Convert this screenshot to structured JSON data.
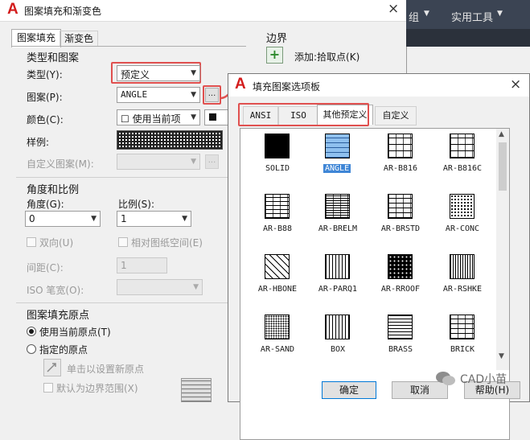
{
  "main_dialog": {
    "title": "图案填充和渐变色",
    "close_glyph": "×",
    "tabs": [
      "图案填充",
      "渐变色"
    ],
    "type_and_pattern": {
      "section": "类型和图案",
      "type_label": "类型(Y):",
      "type_value": "预定义",
      "pattern_label": "图案(P):",
      "pattern_value": "ANGLE",
      "browse_label": "...",
      "color_label": "颜色(C):",
      "color_value": "☐ 使用当前项",
      "swatch_label": "样例:",
      "custom_label": "自定义图案(M):"
    },
    "angle_scale": {
      "section": "角度和比例",
      "angle_label": "角度(G):",
      "angle_value": "0",
      "scale_label": "比例(S):",
      "scale_value": "1",
      "double_label": "双向(U)",
      "relative_label": "相对图纸空间(E)",
      "spacing_label": "间距(C):",
      "spacing_value": "1",
      "iso_label": "ISO 笔宽(O):"
    },
    "origin": {
      "section": "图案填充原点",
      "use_current": "使用当前原点(T)",
      "specified": "指定的原点",
      "click_set": "单击以设置新原点",
      "default_boundary": "默认为边界范围(X)"
    },
    "boundary": {
      "section": "边界",
      "pick_points": "添加:拾取点(K)",
      "pick_icon": "add-pick-point-icon"
    }
  },
  "ribbon": {
    "item1": "组",
    "item2": "实用工具"
  },
  "palette_dialog": {
    "title": "填充图案选项板",
    "close_glyph": "×",
    "tabs": [
      "ANSI",
      "ISO",
      "其他预定义",
      "自定义"
    ],
    "active_tab": "其他预定义",
    "patterns": [
      {
        "name": "SOLID",
        "selected": false
      },
      {
        "name": "ANGLE",
        "selected": true
      },
      {
        "name": "AR-B816",
        "selected": false
      },
      {
        "name": "AR-B816C",
        "selected": false
      },
      {
        "name": "AR-B88",
        "selected": false
      },
      {
        "name": "AR-BRELM",
        "selected": false
      },
      {
        "name": "AR-BRSTD",
        "selected": false
      },
      {
        "name": "AR-CONC",
        "selected": false
      },
      {
        "name": "AR-HBONE",
        "selected": false
      },
      {
        "name": "AR-PARQ1",
        "selected": false
      },
      {
        "name": "AR-RROOF",
        "selected": false
      },
      {
        "name": "AR-RSHKE",
        "selected": false
      },
      {
        "name": "AR-SAND",
        "selected": false
      },
      {
        "name": "BOX",
        "selected": false
      },
      {
        "name": "BRASS",
        "selected": false
      },
      {
        "name": "BRICK",
        "selected": false
      }
    ],
    "ok_label": "确定",
    "cancel_label": "取消",
    "help_label": "帮助(H)"
  },
  "watermark": "CAD小苗",
  "colors": {
    "highlight_red": "#e0504f",
    "selection_blue": "#3f86d6",
    "ribbon_dark": "#3b4453"
  }
}
